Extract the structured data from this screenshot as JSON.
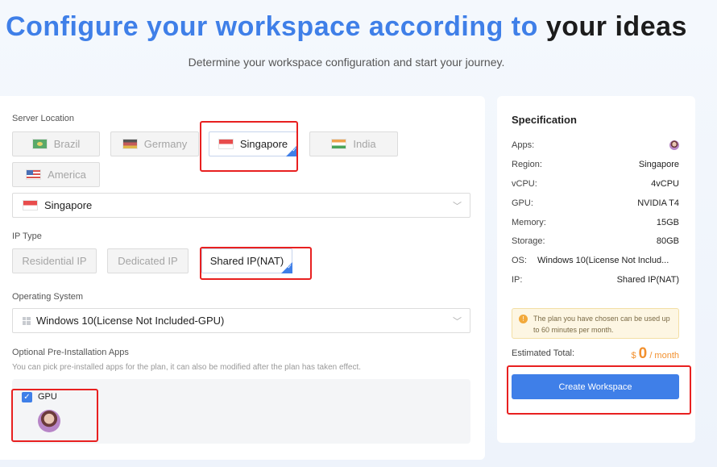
{
  "hero": {
    "title_blue": "Configure your workspace according to",
    "title_dark": "your ideas",
    "subtitle": "Determine your workspace configuration and start your journey."
  },
  "config": {
    "server_location": {
      "label": "Server Location",
      "options": [
        "Brazil",
        "Germany",
        "Singapore",
        "India",
        "America"
      ],
      "selected": "Singapore",
      "dropdown_value": "Singapore"
    },
    "ip_type": {
      "label": "IP Type",
      "options": [
        "Residential IP",
        "Dedicated IP",
        "Shared IP(NAT)"
      ],
      "selected": "Shared IP(NAT)"
    },
    "os": {
      "label": "Operating System",
      "value": "Windows 10(License Not Included-GPU)"
    },
    "apps": {
      "label": "Optional Pre-Installation Apps",
      "hint": "You can pick pre-installed apps for the plan, it can also be modified after the plan has taken effect.",
      "group_label": "GPU",
      "group_checked": true
    }
  },
  "spec": {
    "title": "Specification",
    "rows": [
      {
        "k": "Apps:",
        "v": ""
      },
      {
        "k": "Region:",
        "v": "Singapore"
      },
      {
        "k": "vCPU:",
        "v": "4vCPU"
      },
      {
        "k": "GPU:",
        "v": "NVIDIA T4"
      },
      {
        "k": "Memory:",
        "v": "15GB"
      },
      {
        "k": "Storage:",
        "v": "80GB"
      },
      {
        "k": "OS:",
        "v": "Windows 10(License Not Includ..."
      },
      {
        "k": "IP:",
        "v": "Shared IP(NAT)"
      }
    ],
    "notice": "The plan you have chosen can be used up to 60 minutes per month.",
    "estimated_label": "Estimated Total:",
    "currency": "$",
    "price": "0",
    "period": "/ month",
    "create_label": "Create Workspace"
  },
  "colors": {
    "accent": "#3f7fe8",
    "highlight_box": "#e82020",
    "price": "#f2902e"
  }
}
